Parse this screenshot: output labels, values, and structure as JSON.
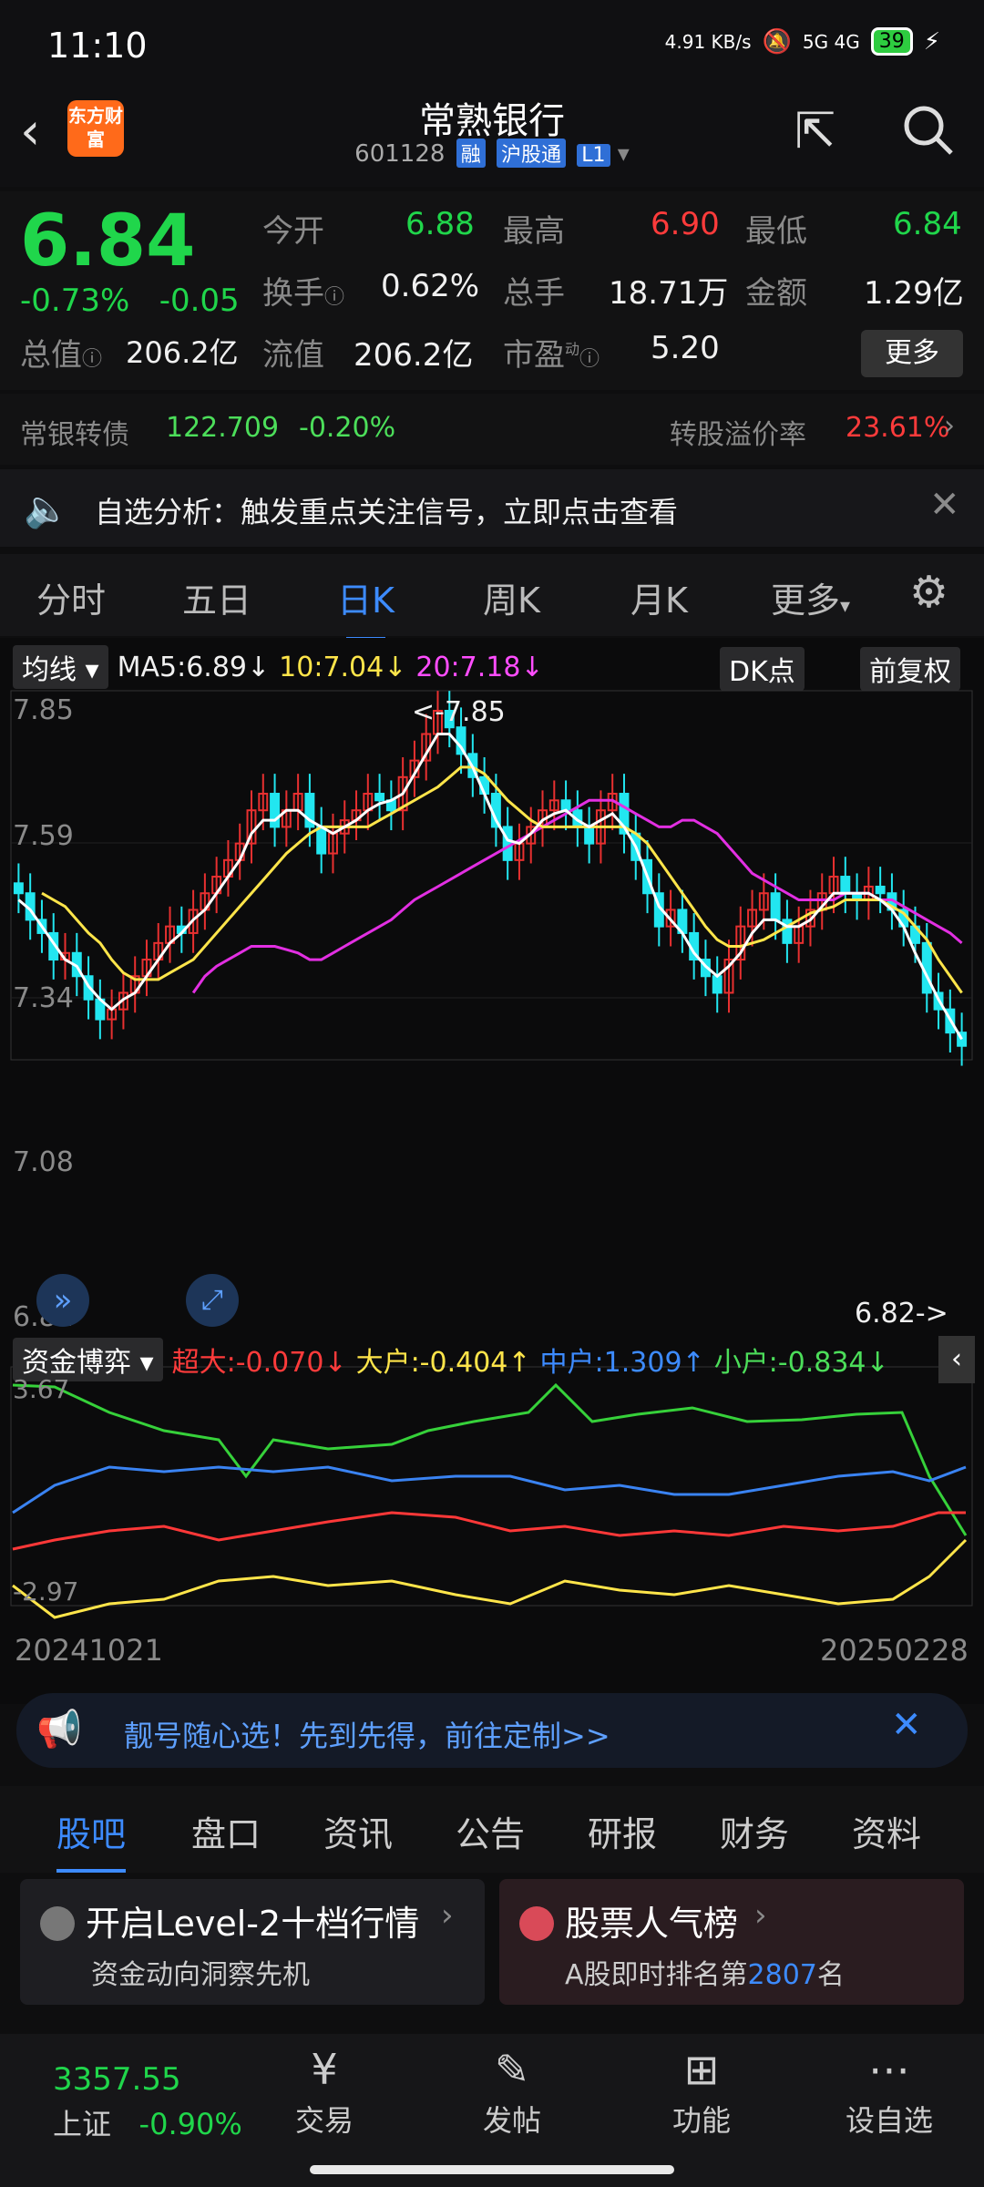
{
  "status_bar": {
    "time": "11:10",
    "net_speed": "4.91 KB/s",
    "network": "5G 4G",
    "battery": "39"
  },
  "header": {
    "back_icon": "chevron-left-icon",
    "logo_text": "东方财富",
    "title": "常熟银行",
    "code": "601128",
    "tags": [
      "融",
      "沪股通",
      "L1"
    ],
    "share_icon": "share-icon",
    "search_icon": "search-icon"
  },
  "quote": {
    "price": "6.84",
    "change_pct": "-0.73%",
    "change": "-0.05",
    "open_label": "今开",
    "open": "6.88",
    "high_label": "最高",
    "high": "6.90",
    "low_label": "最低",
    "low": "6.84",
    "turnover_label": "换手",
    "turnover": "0.62%",
    "volume_label": "总手",
    "volume": "18.71万",
    "amount_label": "金额",
    "amount": "1.29亿",
    "mktcap_label": "总值",
    "mktcap": "206.2亿",
    "float_label": "流值",
    "float": "206.2亿",
    "pe_label": "市盈",
    "pe_sup": "动",
    "pe": "5.20",
    "more": "更多"
  },
  "convertible": {
    "name": "常银转债",
    "price": "122.709",
    "change": "-0.20%",
    "premium_label": "转股溢价率",
    "premium": "23.61%"
  },
  "alert": {
    "text": "自选分析：触发重点关注信号，立即点击查看"
  },
  "tabs": {
    "items": [
      "分时",
      "五日",
      "日K",
      "周K",
      "月K",
      "更多"
    ],
    "active": "日K"
  },
  "kline": {
    "indicator": "均线",
    "ma5": "MA5:6.89",
    "ma10": "10:7.04",
    "ma20": "20:7.18",
    "dk": "DK点",
    "adjust": "前复权",
    "max_label": "<-7.85",
    "min_label": "6.82->",
    "y_ticks": [
      "7.85",
      "7.59",
      "7.34",
      "7.08",
      "6.82"
    ]
  },
  "capital": {
    "title": "资金博弈",
    "super": "超大:-0.070",
    "big": "大户:-0.404",
    "mid": "中户:1.309",
    "small": "小户:-0.834",
    "y_top": "3.67",
    "y_bottom": "-2.97",
    "date_start": "20241021",
    "date_end": "20250228"
  },
  "ad": {
    "text": "靓号随心选！先到先得，前往定制>>"
  },
  "bottom_tabs": {
    "items": [
      "股吧",
      "盘口",
      "资讯",
      "公告",
      "研报",
      "财务",
      "资料"
    ],
    "active": "股吧"
  },
  "cards": {
    "level2_title": "开启Level-2十档行情",
    "level2_sub": "资金动向洞察先机",
    "rank_title": "股票人气榜",
    "rank_sub_prefix": "A股即时排名第",
    "rank_num": "2807",
    "rank_sub_suffix": "名"
  },
  "nav": {
    "index_value": "3357.55",
    "index_name": "上证",
    "index_change": "-0.90%",
    "items": [
      "交易",
      "发帖",
      "功能",
      "设自选"
    ]
  },
  "chart_data": {
    "type": "candlestick",
    "y_range": [
      6.82,
      7.85
    ],
    "closes": [
      7.3,
      7.22,
      7.18,
      7.1,
      7.12,
      7.05,
      6.98,
      6.92,
      6.95,
      7.0,
      7.05,
      7.1,
      7.15,
      7.2,
      7.18,
      7.25,
      7.3,
      7.35,
      7.4,
      7.45,
      7.55,
      7.6,
      7.5,
      7.55,
      7.6,
      7.5,
      7.42,
      7.48,
      7.52,
      7.55,
      7.6,
      7.58,
      7.55,
      7.65,
      7.7,
      7.78,
      7.85,
      7.8,
      7.72,
      7.65,
      7.6,
      7.5,
      7.4,
      7.45,
      7.5,
      7.55,
      7.58,
      7.55,
      7.5,
      7.45,
      7.55,
      7.6,
      7.48,
      7.4,
      7.3,
      7.2,
      7.25,
      7.18,
      7.1,
      7.05,
      7.0,
      7.1,
      7.2,
      7.25,
      7.3,
      7.22,
      7.15,
      7.2,
      7.25,
      7.3,
      7.35,
      7.3,
      7.28,
      7.32,
      7.3,
      7.25,
      7.2,
      7.15,
      7.0,
      6.95,
      6.88,
      6.84
    ],
    "ma5": [
      7.28,
      7.25,
      7.2,
      7.15,
      7.1,
      7.08,
      7.02,
      6.98,
      6.95,
      6.98,
      7.0,
      7.05,
      7.1,
      7.15,
      7.18,
      7.22,
      7.25,
      7.3,
      7.35,
      7.4,
      7.48,
      7.52,
      7.52,
      7.55,
      7.55,
      7.52,
      7.5,
      7.48,
      7.5,
      7.52,
      7.55,
      7.57,
      7.58,
      7.6,
      7.66,
      7.72,
      7.78,
      7.78,
      7.74,
      7.68,
      7.6,
      7.52,
      7.46,
      7.45,
      7.48,
      7.52,
      7.54,
      7.55,
      7.52,
      7.5,
      7.52,
      7.54,
      7.5,
      7.44,
      7.35,
      7.26,
      7.22,
      7.18,
      7.12,
      7.08,
      7.05,
      7.08,
      7.12,
      7.18,
      7.22,
      7.22,
      7.2,
      7.2,
      7.22,
      7.26,
      7.3,
      7.3,
      7.3,
      7.3,
      7.28,
      7.25,
      7.2,
      7.12,
      7.05,
      6.98,
      6.92,
      6.86
    ],
    "ma10": [
      7.3,
      7.28,
      7.26,
      7.22,
      7.18,
      7.15,
      7.1,
      7.06,
      7.04,
      7.04,
      7.04,
      7.06,
      7.08,
      7.1,
      7.14,
      7.18,
      7.22,
      7.26,
      7.3,
      7.34,
      7.38,
      7.42,
      7.45,
      7.48,
      7.5,
      7.5,
      7.5,
      7.5,
      7.5,
      7.52,
      7.54,
      7.56,
      7.58,
      7.6,
      7.62,
      7.65,
      7.68,
      7.68,
      7.66,
      7.62,
      7.58,
      7.55,
      7.52,
      7.5,
      7.5,
      7.5,
      7.5,
      7.5,
      7.5,
      7.5,
      7.5,
      7.48,
      7.45,
      7.4,
      7.35,
      7.3,
      7.25,
      7.2,
      7.16,
      7.14,
      7.14,
      7.15,
      7.16,
      7.18,
      7.2,
      7.22,
      7.24,
      7.25,
      7.26,
      7.28,
      7.28,
      7.28,
      7.28,
      7.26,
      7.24,
      7.2,
      7.16,
      7.1,
      7.05,
      7.0
    ],
    "ma20": [
      7.0,
      7.05,
      7.08,
      7.1,
      7.12,
      7.14,
      7.14,
      7.14,
      7.13,
      7.12,
      7.1,
      7.1,
      7.12,
      7.14,
      7.16,
      7.18,
      7.2,
      7.22,
      7.25,
      7.28,
      7.3,
      7.32,
      7.34,
      7.36,
      7.38,
      7.4,
      7.42,
      7.44,
      7.46,
      7.48,
      7.5,
      7.52,
      7.54,
      7.56,
      7.58,
      7.58,
      7.58,
      7.56,
      7.54,
      7.52,
      7.5,
      7.5,
      7.52,
      7.52,
      7.5,
      7.48,
      7.44,
      7.4,
      7.36,
      7.34,
      7.32,
      7.3,
      7.28,
      7.28,
      7.28,
      7.28,
      7.3,
      7.3,
      7.3,
      7.28,
      7.28,
      7.26,
      7.24,
      7.22,
      7.2,
      7.18,
      7.15
    ]
  }
}
